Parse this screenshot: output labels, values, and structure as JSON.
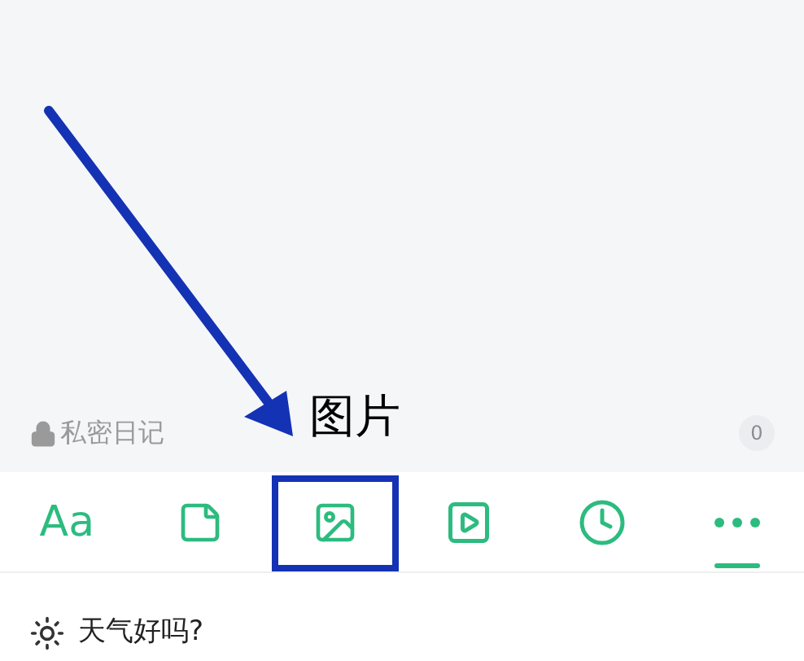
{
  "annotation": {
    "label": "图片"
  },
  "editor": {
    "privacy_label": "私密日记",
    "word_count": "0"
  },
  "toolbar": [
    {
      "kind": "text",
      "label": "Aa",
      "selected": false,
      "highlighted": false
    },
    {
      "kind": "note",
      "selected": false,
      "highlighted": false
    },
    {
      "kind": "image",
      "selected": false,
      "highlighted": true
    },
    {
      "kind": "video",
      "selected": false,
      "highlighted": false
    },
    {
      "kind": "clock",
      "selected": false,
      "highlighted": false
    },
    {
      "kind": "more",
      "selected": true,
      "highlighted": false
    }
  ],
  "weather": {
    "prompt": "天气好吗?"
  }
}
